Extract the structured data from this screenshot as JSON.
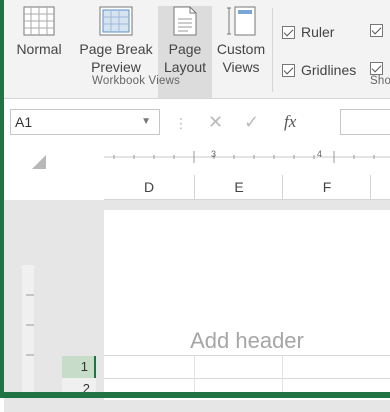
{
  "ribbon": {
    "views": [
      {
        "line1": "Normal",
        "line2": ""
      },
      {
        "line1": "Page Break",
        "line2": "Preview"
      },
      {
        "line1": "Page",
        "line2": "Layout"
      },
      {
        "line1": "Custom",
        "line2": "Views"
      }
    ],
    "workbook_views_label": "Workbook Views",
    "show": {
      "ruler": "Ruler",
      "gridlines": "Gridlines",
      "label_partial": "Sho"
    }
  },
  "formula_bar": {
    "name_box": "A1",
    "fx": "fx"
  },
  "ruler": {
    "marks": [
      "3",
      "4"
    ]
  },
  "columns": [
    "D",
    "E",
    "F"
  ],
  "page": {
    "add_header": "Add header"
  },
  "rows": [
    "1",
    "2"
  ]
}
